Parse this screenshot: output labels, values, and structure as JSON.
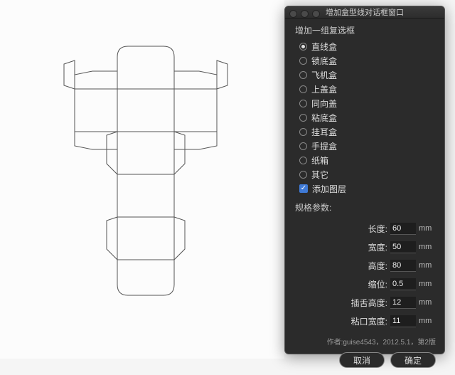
{
  "dialog": {
    "title": "增加盒型线对话框窗口",
    "group_label": "增加一组复选框",
    "options": [
      {
        "label": "直线盒",
        "type": "radio",
        "checked": true
      },
      {
        "label": "锁底盒",
        "type": "radio",
        "checked": false
      },
      {
        "label": "飞机盒",
        "type": "radio",
        "checked": false
      },
      {
        "label": "上盖盒",
        "type": "radio",
        "checked": false
      },
      {
        "label": "同向盖",
        "type": "radio",
        "checked": false
      },
      {
        "label": "粘底盒",
        "type": "radio",
        "checked": false
      },
      {
        "label": "挂耳盒",
        "type": "radio",
        "checked": false
      },
      {
        "label": "手提盒",
        "type": "radio",
        "checked": false
      },
      {
        "label": "纸箱",
        "type": "radio",
        "checked": false
      },
      {
        "label": "其它",
        "type": "radio",
        "checked": false
      },
      {
        "label": "添加图层",
        "type": "check",
        "checked": true
      }
    ],
    "params_label": "规格参数:",
    "params": [
      {
        "label": "长度:",
        "value": "60",
        "unit": "mm"
      },
      {
        "label": "宽度:",
        "value": "50",
        "unit": "mm"
      },
      {
        "label": "高度:",
        "value": "80",
        "unit": "mm"
      },
      {
        "label": "缩位:",
        "value": "0.5",
        "unit": "mm"
      },
      {
        "label": "插舌高度:",
        "value": "12",
        "unit": "mm"
      },
      {
        "label": "粘口宽度:",
        "value": "11",
        "unit": "mm"
      }
    ],
    "footer": "作者:guise4543，2012.5.1，第2版",
    "cancel": "取消",
    "ok": "确定"
  }
}
